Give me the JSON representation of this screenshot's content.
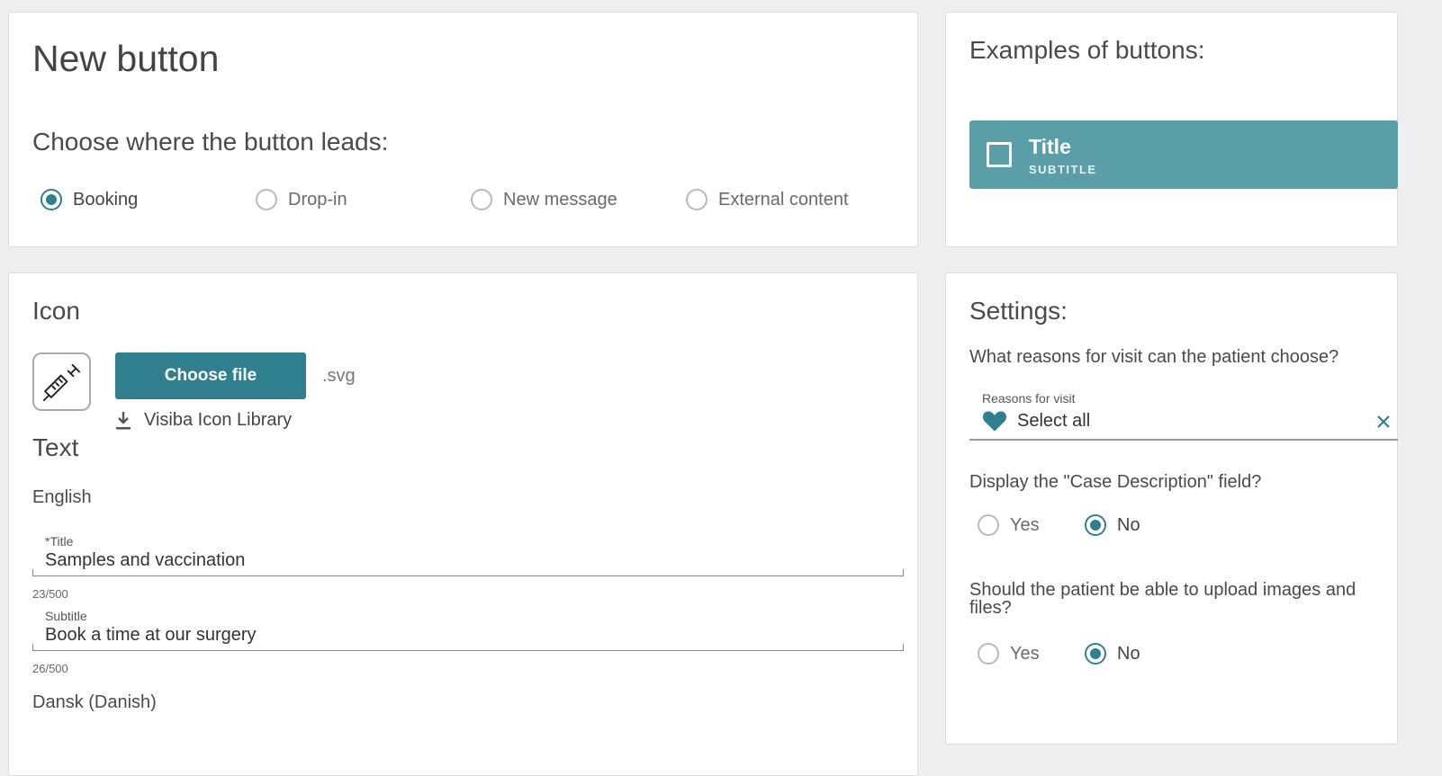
{
  "type_card": {
    "title": "New button",
    "question": "Choose where the button leads:",
    "options": [
      {
        "label": "Booking",
        "checked": true
      },
      {
        "label": "Drop-in",
        "checked": false
      },
      {
        "label": "New message",
        "checked": false
      },
      {
        "label": "External content",
        "checked": false
      }
    ]
  },
  "examples_card": {
    "heading": "Examples of buttons:",
    "example_title": "Title",
    "example_subtitle": "SUBTITLE",
    "accent_color": "#5a9ea8"
  },
  "icon_card": {
    "icon_heading": "Icon",
    "icon_name": "syringe-icon",
    "choose_file_label": "Choose file",
    "file_ext": ".svg",
    "library_link": "Visiba Icon Library",
    "text_heading": "Text",
    "language_en": "English",
    "title_label": "*Title",
    "title_value": "Samples and vaccination",
    "title_counter": "23/500",
    "subtitle_label": "Subtitle",
    "subtitle_value": "Book a time at our surgery",
    "subtitle_counter": "26/500",
    "language_da": "Dansk (Danish)"
  },
  "settings_card": {
    "heading": "Settings:",
    "q_reasons": "What reasons for visit can the patient choose?",
    "reasons_label": "Reasons for visit",
    "reasons_value": "Select all",
    "q_case_description": "Display the \"Case Description\" field?",
    "case_yes": "Yes",
    "case_no": "No",
    "case_selected": "No",
    "q_upload": "Should the patient be able to upload images and files?",
    "upload_yes": "Yes",
    "upload_no": "No",
    "upload_selected": "No"
  },
  "colors": {
    "primary": "#2f7f8f",
    "background": "#efefef"
  }
}
